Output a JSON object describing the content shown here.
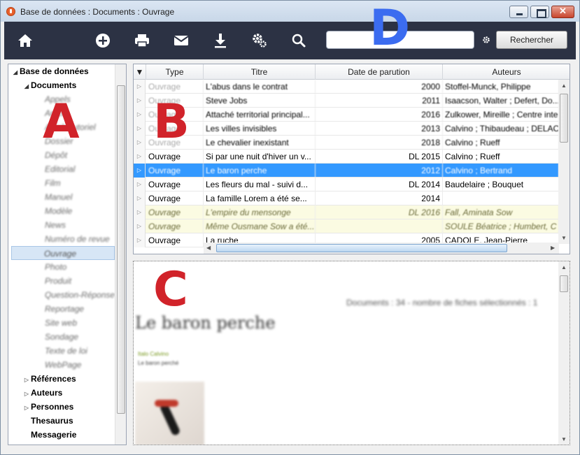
{
  "window": {
    "title": "Base de données : Documents : Ouvrage",
    "close_glyph": "✕"
  },
  "toolbar": {
    "icons": [
      "home-icon",
      "add-icon",
      "print-icon",
      "mail-icon",
      "download-icon",
      "settings-icon",
      "search-icon"
    ],
    "search_value": "",
    "search_button": "Rechercher"
  },
  "overlay_labels": {
    "a": "A",
    "b": "B",
    "c": "C",
    "d": "D"
  },
  "tree": {
    "root": "Base de données",
    "documents": "Documents",
    "doc_types": [
      "Appels",
      "Article",
      "Article tutoriel",
      "Dossier",
      "Dépôt",
      "Editorial",
      "Film",
      "Manuel",
      "Modèle",
      "News",
      "Numéro de revue",
      "Ouvrage",
      "Photo",
      "Produit",
      "Question-Réponse",
      "Reportage",
      "Site web",
      "Sondage",
      "Texte de loi",
      "WebPage"
    ],
    "selected": "Ouvrage",
    "sections": [
      "Références",
      "Auteurs",
      "Personnes",
      "Thesaurus",
      "Messagerie"
    ]
  },
  "grid": {
    "columns": [
      "Type",
      "Titre",
      "Date de parution",
      "Auteurs"
    ],
    "rows": [
      {
        "type": "Ouvrage",
        "title": "L'abus dans le contrat",
        "date": "2000",
        "authors": "Stoffel-Munck, Philippe",
        "style": "grey"
      },
      {
        "type": "Ouvrage",
        "title": "Steve Jobs",
        "date": "2011",
        "authors": "Isaacson, Walter ; Defert, Do...",
        "style": "grey"
      },
      {
        "type": "Ouvrage",
        "title": "Attaché territorial principal...",
        "date": "2016",
        "authors": "Zulkower, Mireille ; Centre inte",
        "style": "grey"
      },
      {
        "type": "Ouvrage",
        "title": "Les villes invisibles",
        "date": "2013",
        "authors": "Calvino ; Thibaudeau ; DELAC",
        "style": "grey"
      },
      {
        "type": "Ouvrage",
        "title": "Le chevalier inexistant",
        "date": "2018",
        "authors": "Calvino ; Rueff",
        "style": "grey"
      },
      {
        "type": "Ouvrage",
        "title": "Si par une nuit d'hiver un v...",
        "date": "DL 2015",
        "authors": "Calvino ; Rueff",
        "style": "normal"
      },
      {
        "type": "Ouvrage",
        "title": "Le baron perche",
        "date": "2012",
        "authors": "Calvino ; Bertrand",
        "style": "selected"
      },
      {
        "type": "Ouvrage",
        "title": "Les fleurs du mal - suivi d...",
        "date": "DL 2014",
        "authors": "Baudelaire ; Bouquet",
        "style": "normal"
      },
      {
        "type": "Ouvrage",
        "title": "La famille Lorem a été se...",
        "date": "2014",
        "authors": "",
        "style": "normal"
      },
      {
        "type": "Ouvrage",
        "title": "L'empire du mensonge",
        "date": "DL 2016",
        "authors": "Fall, Aminata Sow",
        "style": "yellow"
      },
      {
        "type": "Ouvrage",
        "title": "Même Ousmane Sow a été...",
        "date": "",
        "authors": "SOULE Béatrice ; Humbert, C",
        "style": "yellow"
      },
      {
        "type": "Ouvrage",
        "title": "La ruche",
        "date": "2005",
        "authors": "CADOLE, Jean-Pierre",
        "style": "normal"
      }
    ]
  },
  "preview": {
    "count": "Documents : 34 - nombre de fiches sélectionnés : 1",
    "title": "Le baron perche",
    "author": "Italo Calvino",
    "subtitle": "Le baron perché"
  }
}
